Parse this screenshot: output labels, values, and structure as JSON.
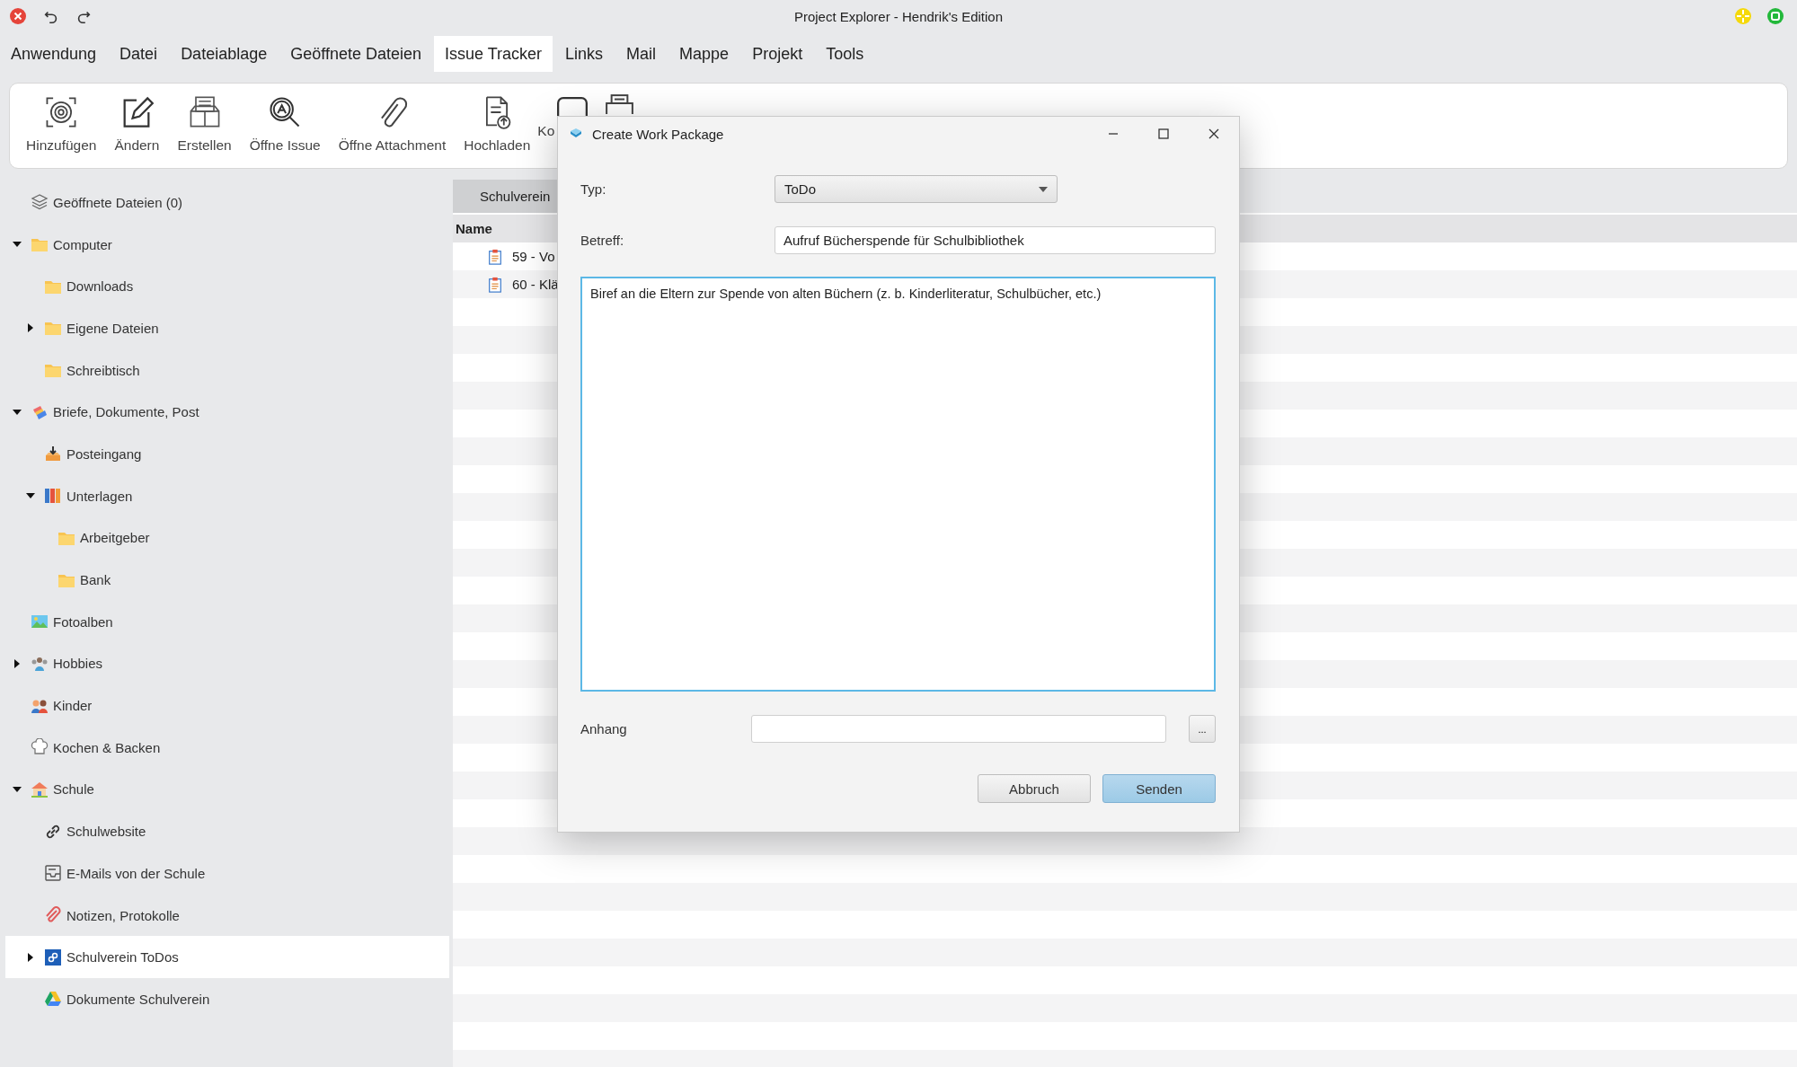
{
  "window": {
    "title": "Project Explorer - Hendrik's Edition"
  },
  "menu": [
    {
      "label": "Anwendung",
      "selected": false
    },
    {
      "label": "Datei",
      "selected": false
    },
    {
      "label": "Dateiablage",
      "selected": false
    },
    {
      "label": "Geöffnete Dateien",
      "selected": false
    },
    {
      "label": "Issue Tracker",
      "selected": true
    },
    {
      "label": "Links",
      "selected": false
    },
    {
      "label": "Mail",
      "selected": false
    },
    {
      "label": "Mappe",
      "selected": false
    },
    {
      "label": "Projekt",
      "selected": false
    },
    {
      "label": "Tools",
      "selected": false
    }
  ],
  "toolbar": [
    {
      "label": "Hinzufügen",
      "kind": "target"
    },
    {
      "label": "Ändern",
      "kind": "edit"
    },
    {
      "label": "Erstellen",
      "kind": "box"
    },
    {
      "label": "Öffne Issue",
      "kind": "search"
    },
    {
      "label": "Öffne Attachment",
      "kind": "clip"
    },
    {
      "label": "Hochladen",
      "kind": "upload"
    },
    {
      "label": "Ko",
      "kind": "frame"
    },
    {
      "kind": "printer"
    }
  ],
  "sidebar": {
    "items": [
      {
        "label": "Geöffnete Dateien (0)",
        "kind": "stack",
        "selected": false
      },
      {
        "label": "Computer",
        "kind": "folder",
        "selected": false,
        "expanded": true,
        "children": [
          {
            "label": "Downloads",
            "kind": "folder",
            "selected": false
          },
          {
            "label": "Eigene Dateien",
            "kind": "folder",
            "selected": false,
            "expanded": false
          },
          {
            "label": "Schreibtisch",
            "kind": "folder",
            "selected": false
          }
        ]
      },
      {
        "label": "Briefe, Dokumente, Post",
        "kind": "boxes",
        "selected": false,
        "expanded": true,
        "children": [
          {
            "label": "Posteingang",
            "kind": "inbox",
            "selected": false
          },
          {
            "label": "Unterlagen",
            "kind": "binder",
            "selected": false,
            "expanded": true,
            "children": [
              {
                "label": "Arbeitgeber",
                "kind": "folder",
                "selected": false
              },
              {
                "label": "Bank",
                "kind": "folder",
                "selected": false
              }
            ]
          }
        ]
      },
      {
        "label": "Fotoalben",
        "kind": "photo",
        "selected": false
      },
      {
        "label": "Hobbies",
        "kind": "people",
        "selected": false,
        "expanded": false
      },
      {
        "label": "Kinder",
        "kind": "kids",
        "selected": false
      },
      {
        "label": "Kochen & Backen",
        "kind": "chef",
        "selected": false
      },
      {
        "label": "Schule",
        "kind": "school",
        "selected": false,
        "expanded": true,
        "children": [
          {
            "label": "Schulwebsite",
            "kind": "link",
            "selected": false
          },
          {
            "label": "E-Mails von der Schule",
            "kind": "mail",
            "selected": false
          },
          {
            "label": "Notizen, Protokolle",
            "kind": "note",
            "selected": false
          },
          {
            "label": "Schulverein ToDos",
            "kind": "app",
            "selected": true,
            "expanded": false
          },
          {
            "label": "Dokumente Schulverein",
            "kind": "drive",
            "selected": false
          }
        ]
      }
    ]
  },
  "list": {
    "tab": "Schulverein",
    "columns": [
      "Name"
    ],
    "rows": [
      {
        "name": "59 - Vo"
      },
      {
        "name": "60 - Klä"
      }
    ]
  },
  "dialog": {
    "title": "Create Work Package",
    "type_label": "Typ:",
    "type_value": "ToDo",
    "subject_label": "Betreff:",
    "subject_value": "Aufruf Bücherspende für Schulbibliothek",
    "description": {
      "value": "Biref an die Eltern zur Spende von alten Büchern (z. b. Kinderliteratur, Schulbücher, etc.)",
      "focused": true
    },
    "attachment_label": "Anhang",
    "browse_button": "...",
    "buttons": [
      {
        "label": "Abbruch",
        "default": false
      },
      {
        "label": "Senden",
        "default": true
      }
    ]
  }
}
